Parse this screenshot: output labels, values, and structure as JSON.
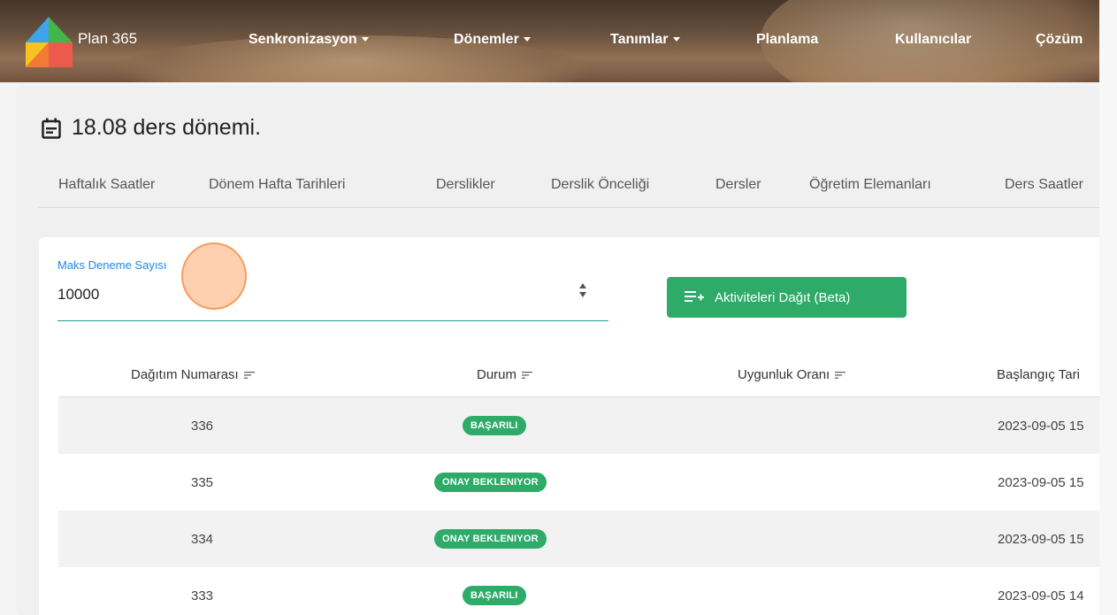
{
  "navbar": {
    "brand": "Plan 365",
    "items": [
      {
        "label": "Senkronizasyon",
        "dropdown": true
      },
      {
        "label": "Dönemler",
        "dropdown": true
      },
      {
        "label": "Tanımlar",
        "dropdown": true
      },
      {
        "label": "Planlama",
        "dropdown": false
      },
      {
        "label": "Kullanıcılar",
        "dropdown": false
      },
      {
        "label": "Çözüm",
        "dropdown": false
      }
    ]
  },
  "page": {
    "title": "18.08 ders dönemi.",
    "title_icon": "calendar-icon"
  },
  "tabs": [
    "Haftalık Saatler",
    "Dönem Hafta Tarihleri",
    "Derslikler",
    "Derslik Önceliği",
    "Dersler",
    "Öğretim Elemanları",
    "Ders Saatler"
  ],
  "form": {
    "label": "Maks Deneme Sayısı",
    "value": "10000",
    "button_label": "Aktiviteleri Dağıt (Beta)",
    "button_icon": "playlist-add-icon"
  },
  "table": {
    "headers": [
      "Dağıtım Numarası",
      "Durum",
      "Uygunluk Oranı",
      "Başlangıç Tari"
    ],
    "rows": [
      {
        "id": "336",
        "status": "BAŞARILI",
        "ratio": "",
        "start": "2023-09-05 15"
      },
      {
        "id": "335",
        "status": "ONAY BEKLENIYOR",
        "ratio": "",
        "start": "2023-09-05 15"
      },
      {
        "id": "334",
        "status": "ONAY BEKLENIYOR",
        "ratio": "",
        "start": "2023-09-05 15"
      },
      {
        "id": "333",
        "status": "BAŞARILI",
        "ratio": "",
        "start": "2023-09-05 14"
      }
    ]
  },
  "colors": {
    "accent": "#2eaa69",
    "label_blue": "#1e88e5",
    "underline": "#1e9e94"
  }
}
